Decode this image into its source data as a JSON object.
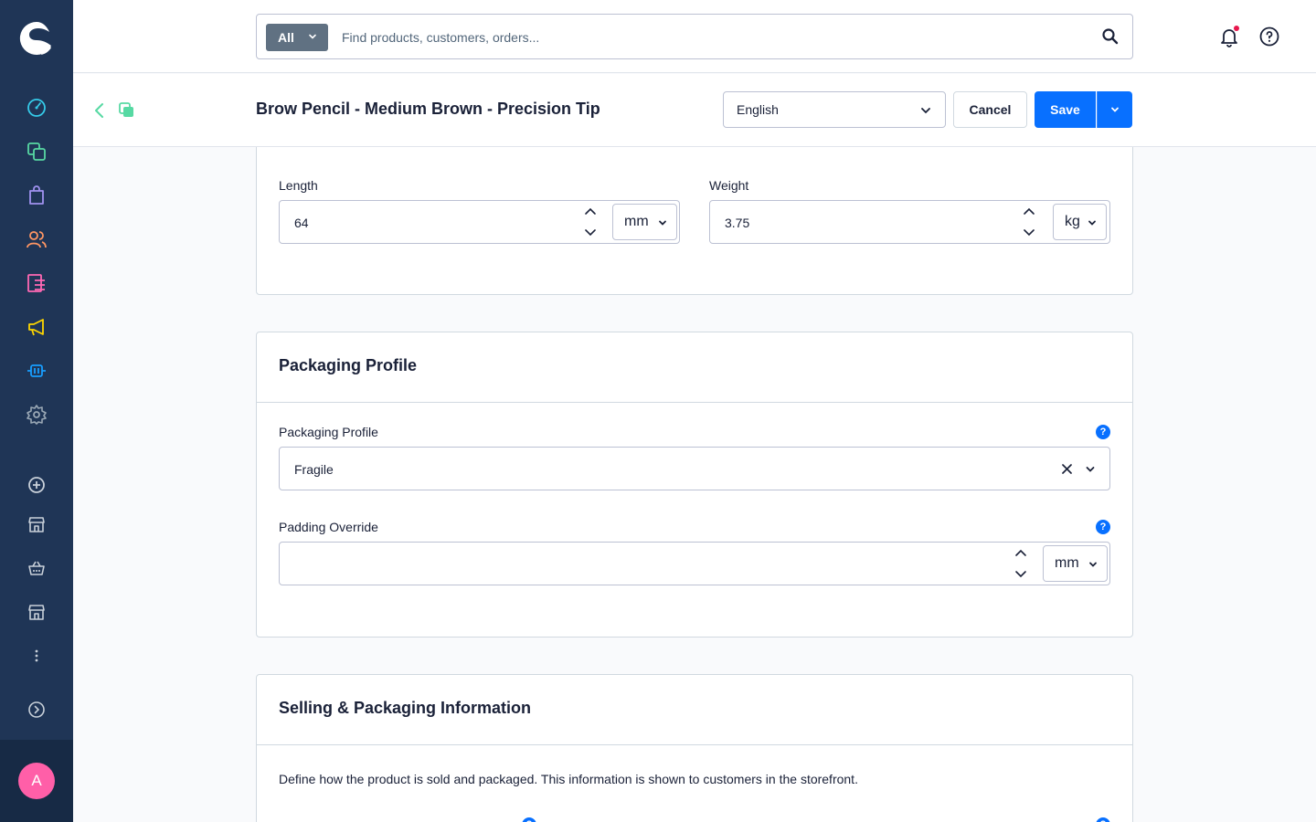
{
  "sidebar": {
    "nav": [
      {
        "icon": "dashboard-icon",
        "color": "#35cbe9"
      },
      {
        "icon": "catalogues-icon",
        "color": "#57d9a3"
      },
      {
        "icon": "orders-icon",
        "color": "#a092f0"
      },
      {
        "icon": "customers-icon",
        "color": "#ff9663"
      },
      {
        "icon": "content-icon",
        "color": "#ff68b4"
      },
      {
        "icon": "marketing-icon",
        "color": "#ffd700"
      },
      {
        "icon": "extensions-icon",
        "color": "#189eff"
      },
      {
        "icon": "settings-icon",
        "color": "#9aa8b5"
      }
    ],
    "secondary": [
      "add-sales-channel-icon",
      "storefront-icon",
      "headless-icon",
      "storefront-icon",
      "more-icon"
    ],
    "collapse_icon": "chevron-right-circle-icon",
    "avatar_initial": "A",
    "avatar_color": "#ff5fa8"
  },
  "header": {
    "search_type": "All",
    "search_placeholder": "Find products, customers, orders...",
    "notification_icon": "bell-icon",
    "help_icon": "help-circle-icon"
  },
  "smartbar": {
    "title": "Brow Pencil - Medium Brown - Precision Tip",
    "language": "English",
    "cancel_label": "Cancel",
    "save_label": "Save"
  },
  "measures": {
    "length_label": "Length",
    "length_value": "64",
    "length_unit": "mm",
    "weight_label": "Weight",
    "weight_value": "3.75",
    "weight_unit": "kg"
  },
  "packaging": {
    "title": "Packaging Profile",
    "profile_label": "Packaging Profile",
    "profile_value": "Fragile",
    "padding_label": "Padding Override",
    "padding_value": "",
    "padding_unit": "mm",
    "help_mark": "?"
  },
  "selling": {
    "title": "Selling & Packaging Information",
    "description": "Define how the product is sold and packaged. This information is shown to customers in the storefront."
  },
  "colors": {
    "primary": "#0870ff",
    "sidebar": "#1f3556",
    "notification_dot": "#e8174d"
  }
}
